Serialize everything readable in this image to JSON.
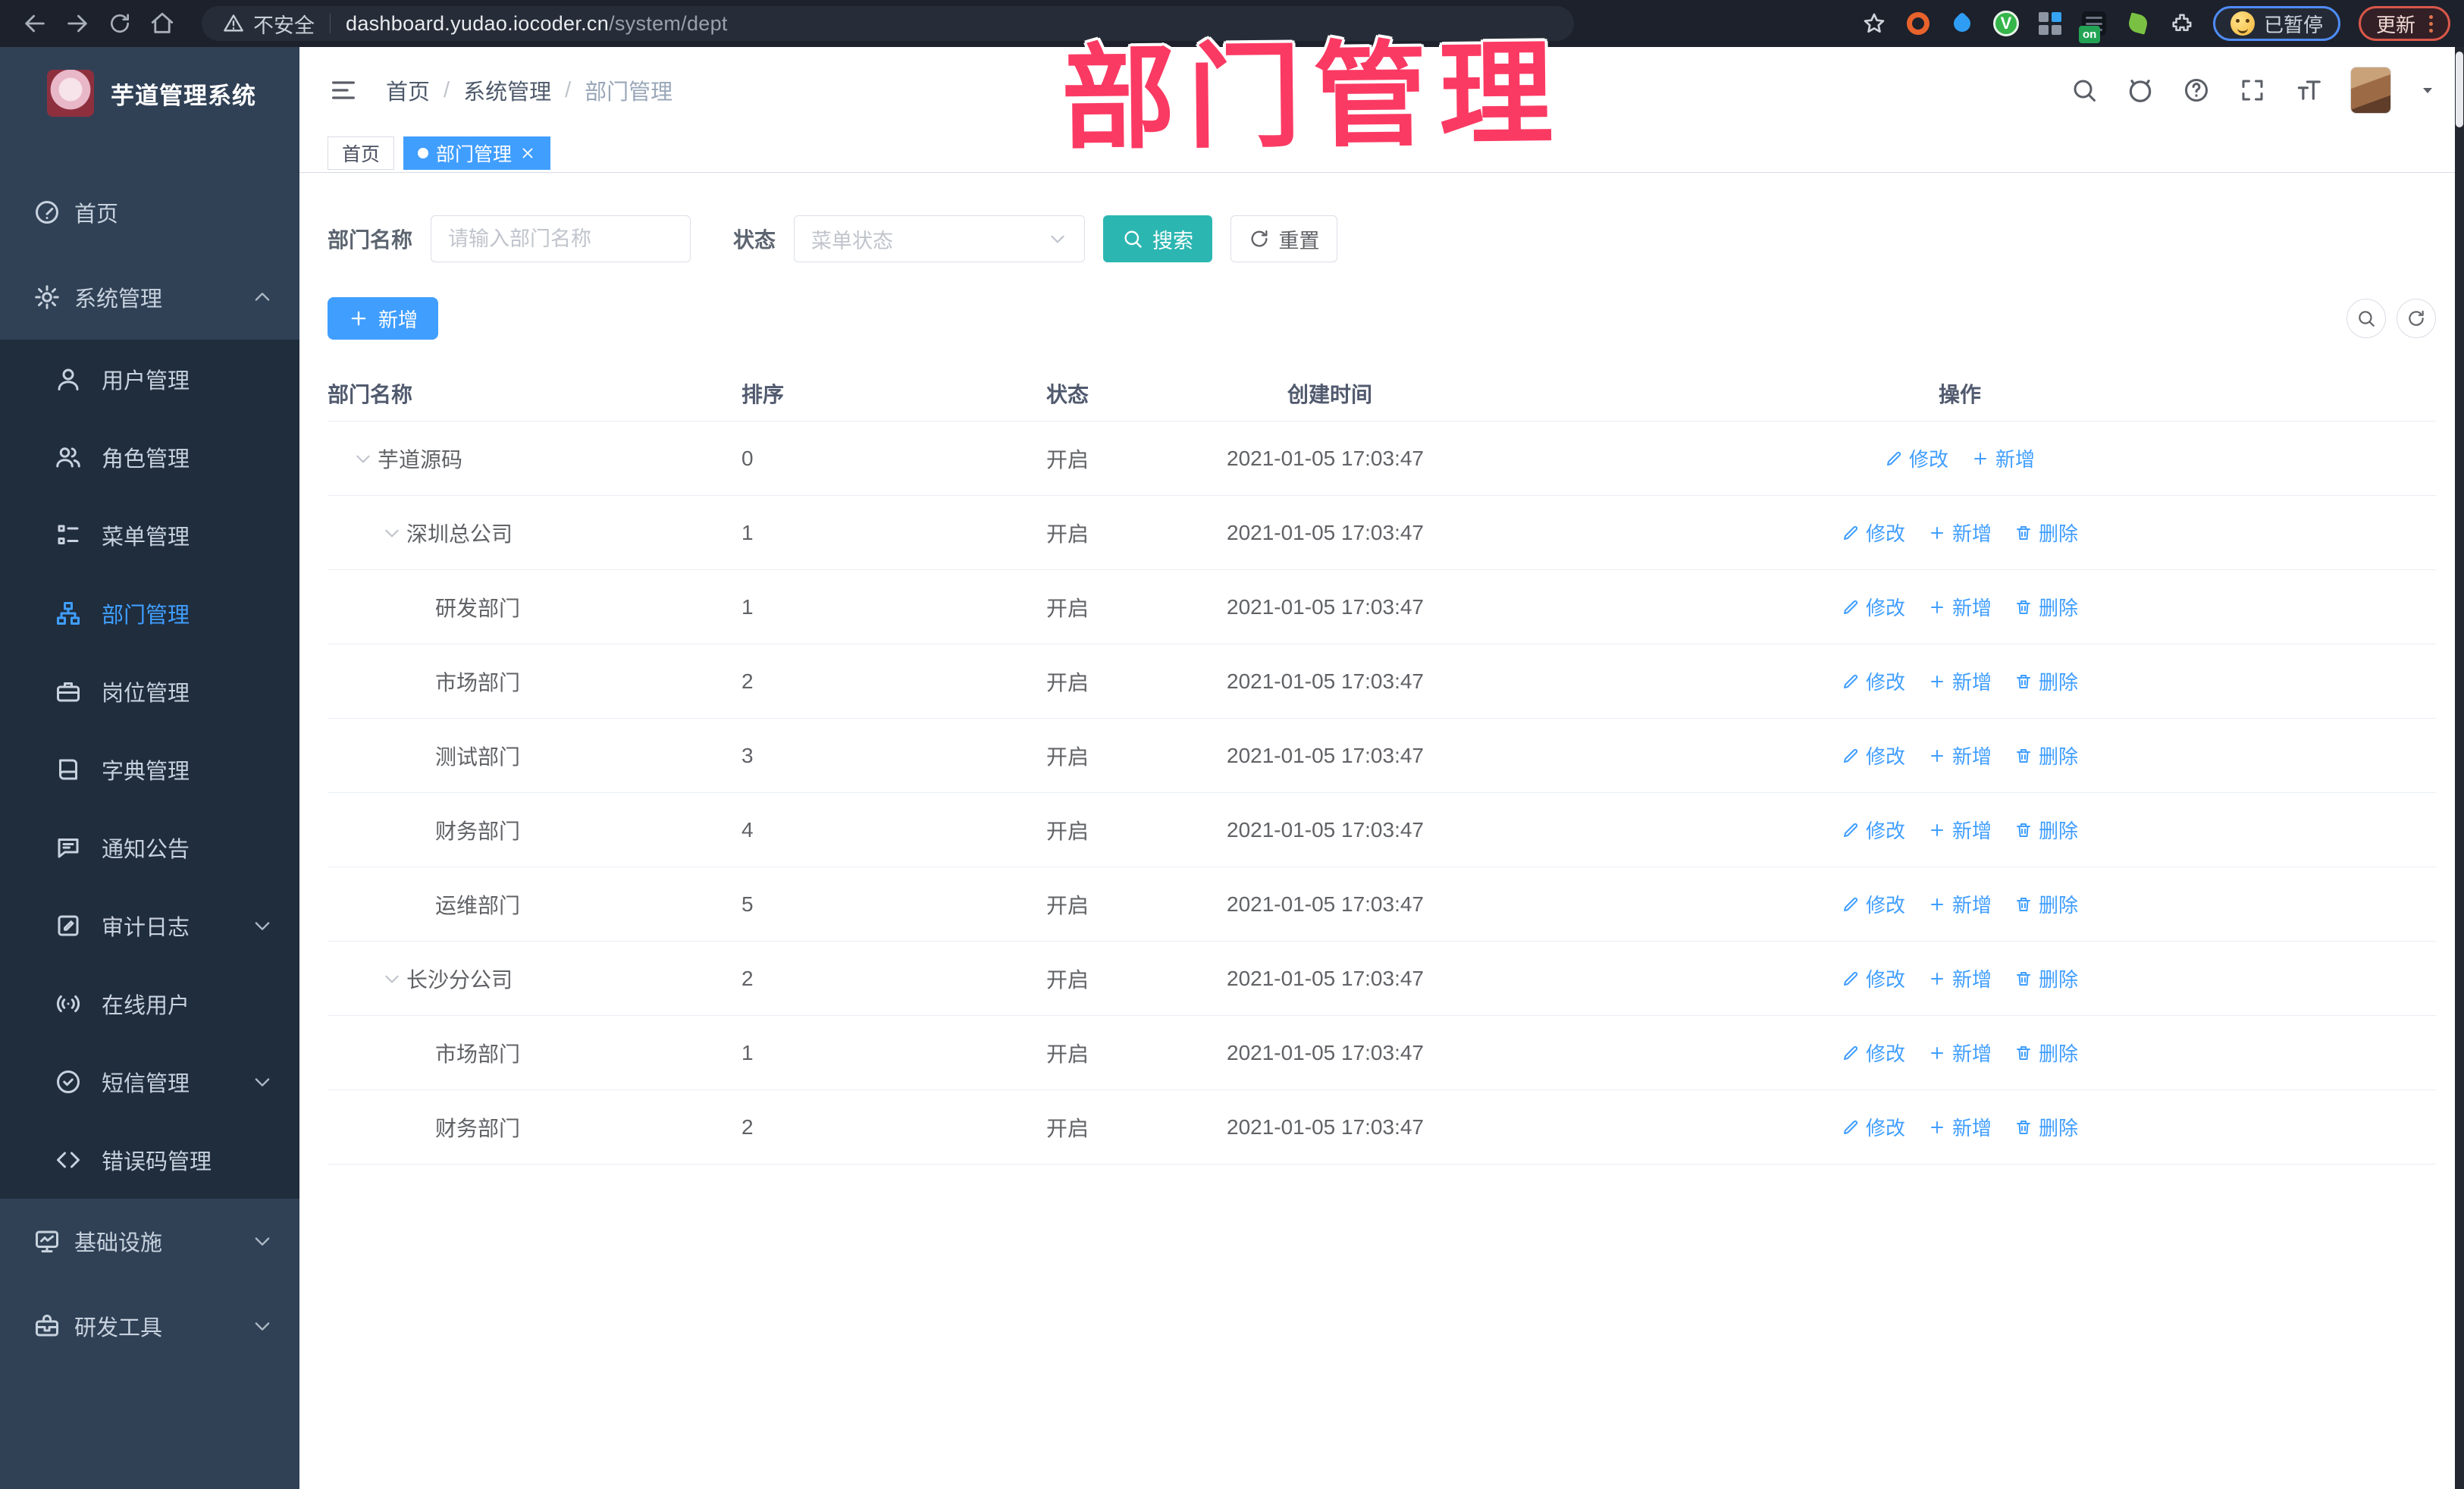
{
  "browser": {
    "security_label": "不安全",
    "url_host": "dashboard.yudao.iocoder.cn",
    "url_path": "/system/dept",
    "paused_label": "已暂停",
    "update_label": "更新"
  },
  "overlay": {
    "title": "部门管理"
  },
  "sidebar": {
    "app_title": "芋道管理系统",
    "items": [
      {
        "label": "首页",
        "icon": "i-dashboard",
        "level": 0
      },
      {
        "label": "系统管理",
        "icon": "i-gear",
        "level": 0,
        "chevron": "up"
      },
      {
        "label": "用户管理",
        "icon": "i-user",
        "level": 1
      },
      {
        "label": "角色管理",
        "icon": "i-users",
        "level": 1
      },
      {
        "label": "菜单管理",
        "icon": "i-menutree",
        "level": 1
      },
      {
        "label": "部门管理",
        "icon": "i-orgtree",
        "level": 1,
        "active": true
      },
      {
        "label": "岗位管理",
        "icon": "i-briefcase",
        "level": 1
      },
      {
        "label": "字典管理",
        "icon": "i-book",
        "level": 1
      },
      {
        "label": "通知公告",
        "icon": "i-megaphone",
        "level": 1
      },
      {
        "label": "审计日志",
        "icon": "i-log",
        "level": 1,
        "chevron": "down"
      },
      {
        "label": "在线用户",
        "icon": "i-online",
        "level": 1
      },
      {
        "label": "短信管理",
        "icon": "i-sms",
        "level": 1,
        "chevron": "down"
      },
      {
        "label": "错误码管理",
        "icon": "i-code",
        "level": 1
      },
      {
        "label": "基础设施",
        "icon": "i-infra",
        "level": 0,
        "chevron": "down"
      },
      {
        "label": "研发工具",
        "icon": "i-tools",
        "level": 0,
        "chevron": "down"
      }
    ]
  },
  "header": {
    "breadcrumb": [
      "首页",
      "系统管理",
      "部门管理"
    ]
  },
  "tabs": [
    {
      "label": "首页",
      "active": false,
      "closable": false
    },
    {
      "label": "部门管理",
      "active": true,
      "closable": true
    }
  ],
  "filters": {
    "dept_name_label": "部门名称",
    "dept_name_placeholder": "请输入部门名称",
    "status_label": "状态",
    "status_placeholder": "菜单状态",
    "search_label": "搜索",
    "reset_label": "重置"
  },
  "toolbar": {
    "add_label": "新增"
  },
  "table": {
    "columns": [
      "部门名称",
      "排序",
      "状态",
      "创建时间",
      "操作"
    ],
    "rows": [
      {
        "name": "芋道源码",
        "level": 0,
        "expandable": true,
        "sort": "0",
        "status": "开启",
        "created": "2021-01-05 17:03:47",
        "actions": [
          "修改",
          "新增"
        ]
      },
      {
        "name": "深圳总公司",
        "level": 1,
        "expandable": true,
        "sort": "1",
        "status": "开启",
        "created": "2021-01-05 17:03:47",
        "actions": [
          "修改",
          "新增",
          "删除"
        ]
      },
      {
        "name": "研发部门",
        "level": 2,
        "expandable": false,
        "sort": "1",
        "status": "开启",
        "created": "2021-01-05 17:03:47",
        "actions": [
          "修改",
          "新增",
          "删除"
        ]
      },
      {
        "name": "市场部门",
        "level": 2,
        "expandable": false,
        "sort": "2",
        "status": "开启",
        "created": "2021-01-05 17:03:47",
        "actions": [
          "修改",
          "新增",
          "删除"
        ]
      },
      {
        "name": "测试部门",
        "level": 2,
        "expandable": false,
        "sort": "3",
        "status": "开启",
        "created": "2021-01-05 17:03:47",
        "actions": [
          "修改",
          "新增",
          "删除"
        ]
      },
      {
        "name": "财务部门",
        "level": 2,
        "expandable": false,
        "sort": "4",
        "status": "开启",
        "created": "2021-01-05 17:03:47",
        "actions": [
          "修改",
          "新增",
          "删除"
        ]
      },
      {
        "name": "运维部门",
        "level": 2,
        "expandable": false,
        "sort": "5",
        "status": "开启",
        "created": "2021-01-05 17:03:47",
        "actions": [
          "修改",
          "新增",
          "删除"
        ]
      },
      {
        "name": "长沙分公司",
        "level": 1,
        "expandable": true,
        "sort": "2",
        "status": "开启",
        "created": "2021-01-05 17:03:47",
        "actions": [
          "修改",
          "新增",
          "删除"
        ]
      },
      {
        "name": "市场部门",
        "level": 2,
        "expandable": false,
        "sort": "1",
        "status": "开启",
        "created": "2021-01-05 17:03:47",
        "actions": [
          "修改",
          "新增",
          "删除"
        ]
      },
      {
        "name": "财务部门",
        "level": 2,
        "expandable": false,
        "sort": "2",
        "status": "开启",
        "created": "2021-01-05 17:03:47",
        "actions": [
          "修改",
          "新增",
          "删除"
        ]
      }
    ]
  },
  "colors": {
    "primary": "#409eff",
    "search_button": "#2cb6b1",
    "overlay_pink": "#fb3a63",
    "sidebar_bg": "#304156",
    "sidebar_sub_bg": "#1f2d3d",
    "browser_bar_bg": "#1c212b"
  }
}
